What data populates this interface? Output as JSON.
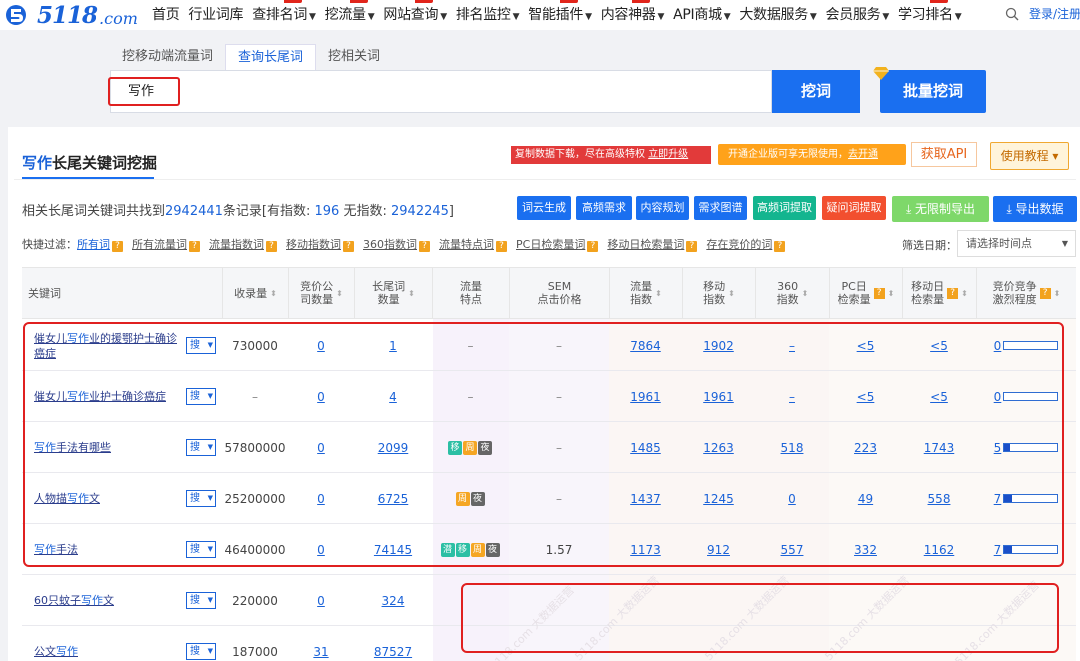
{
  "logo": {
    "text": "5118",
    "suffix": ".com"
  },
  "nav": {
    "items": [
      {
        "label": "首页",
        "caret": false,
        "new": false
      },
      {
        "label": "行业词库",
        "caret": false,
        "new": false
      },
      {
        "label": "查排名词",
        "caret": true,
        "new": true
      },
      {
        "label": "挖流量",
        "caret": true,
        "new": true
      },
      {
        "label": "网站查询",
        "caret": true,
        "new": true
      },
      {
        "label": "排名监控",
        "caret": true,
        "new": false
      },
      {
        "label": "智能插件",
        "caret": true,
        "new": true
      },
      {
        "label": "内容神器",
        "caret": true,
        "new": true
      },
      {
        "label": "API商城",
        "caret": true,
        "new": false
      },
      {
        "label": "大数据服务",
        "caret": true,
        "new": false
      },
      {
        "label": "会员服务",
        "caret": true,
        "new": false
      },
      {
        "label": "学习排名",
        "caret": true,
        "new": true
      }
    ],
    "login": "登录/注册"
  },
  "tabs": [
    "挖移动端流量词",
    "查询长尾词",
    "挖相关词"
  ],
  "search": {
    "value": "写作",
    "dig_button": "挖词",
    "batch_button": "批量挖词"
  },
  "panel": {
    "title_kw": "写作",
    "title_rest": "长尾关键词挖掘",
    "notice1_text": "复制数据下载，尽在高级特权 ",
    "notice1_link": "立即升级",
    "notice2_text": "开通企业版可享无限使用，",
    "notice2_link": "去开通",
    "api_button": "获取API",
    "tutorial_button": "使用教程 ▾"
  },
  "summary": {
    "prefix": "相关长尾词关键词共找到",
    "total": "2942441",
    "mid1": "条记录[有指数: ",
    "with_index": "196",
    "mid2": " 无指数: ",
    "without_index": "2942245",
    "suffix": "]"
  },
  "action_buttons": [
    {
      "label": "词云生成",
      "color": "#1a6ff0"
    },
    {
      "label": "高频需求",
      "color": "#1a6ff0"
    },
    {
      "label": "内容规划",
      "color": "#1a6ff0"
    },
    {
      "label": "需求图谱",
      "color": "#1a6ff0"
    },
    {
      "label": "高频词提取",
      "color": "#13b58f"
    },
    {
      "label": "疑问词提取",
      "color": "#f24f2f"
    },
    {
      "label": "⤓ 无限制导出",
      "color": "#7ed86a"
    },
    {
      "label": "⤓ 导出数据",
      "color": "#1a6ff0"
    }
  ],
  "filter": {
    "label": "快捷过滤：",
    "items": [
      "所有词",
      "所有流量词",
      "流量指数词",
      "移动指数词",
      "360指数词",
      "流量特点词",
      "PC日检索量词",
      "移动日检索量词",
      "存在竞价的词"
    ],
    "date_label": "筛选日期：",
    "date_placeholder": "请选择时间点"
  },
  "table": {
    "headers": [
      "关键词",
      "收录量",
      "竞价公\n司数量",
      "长尾词\n数量",
      "流量\n特点",
      "SEM\n点击价格",
      "流量\n指数",
      "移动\n指数",
      "360\n指数",
      "PC日\n检索量",
      "移动日\n检索量",
      "竞价竞争\n激烈程度"
    ],
    "rows": [
      {
        "kw_pre": "催女儿",
        "kw_hl": "写作",
        "kw_post": "业的援鄂护士确诊癌症",
        "indexed": "730000",
        "bid": "0",
        "longtail": "1",
        "tags": [],
        "sem": "–",
        "flow": "7864",
        "mobile": "1902",
        "idx360": "–",
        "pc": "<5",
        "mob_daily": "<5",
        "comp": "0",
        "comp_pct": 0
      },
      {
        "kw_pre": "催女儿",
        "kw_hl": "写作",
        "kw_post": "业护士确诊癌症",
        "indexed": "–",
        "bid": "0",
        "longtail": "4",
        "tags": [],
        "sem": "–",
        "flow": "1961",
        "mobile": "1961",
        "idx360": "–",
        "pc": "<5",
        "mob_daily": "<5",
        "comp": "0",
        "comp_pct": 0
      },
      {
        "kw_pre": "",
        "kw_hl": "写作",
        "kw_post": "手法有哪些",
        "indexed": "57800000",
        "bid": "0",
        "longtail": "2099",
        "tags": [
          "移",
          "周",
          "夜"
        ],
        "sem": "–",
        "flow": "1485",
        "mobile": "1263",
        "idx360": "518",
        "pc": "223",
        "mob_daily": "1743",
        "comp": "5",
        "comp_pct": 10
      },
      {
        "kw_pre": "人物描",
        "kw_hl": "写作",
        "kw_post": "文",
        "indexed": "25200000",
        "bid": "0",
        "longtail": "6725",
        "tags": [
          "周",
          "夜"
        ],
        "sem": "–",
        "flow": "1437",
        "mobile": "1245",
        "idx360": "0",
        "pc": "49",
        "mob_daily": "558",
        "comp": "7",
        "comp_pct": 14
      },
      {
        "kw_pre": "",
        "kw_hl": "写作",
        "kw_post": "手法",
        "indexed": "46400000",
        "bid": "0",
        "longtail": "74145",
        "tags": [
          "潜",
          "移",
          "周",
          "夜"
        ],
        "sem": "1.57",
        "flow": "1173",
        "mobile": "912",
        "idx360": "557",
        "pc": "332",
        "mob_daily": "1162",
        "comp": "7",
        "comp_pct": 14
      },
      {
        "kw_pre": "60只蚊子",
        "kw_hl": "写作",
        "kw_post": "文",
        "indexed": "220000",
        "bid": "0",
        "longtail": "324",
        "tags": [],
        "sem": "",
        "flow": "",
        "mobile": "",
        "idx360": "",
        "pc": "",
        "mob_daily": "",
        "comp": "",
        "comp_pct": 0
      },
      {
        "kw_pre": "公文",
        "kw_hl": "写作",
        "kw_post": "",
        "indexed": "187000",
        "bid": "31",
        "longtail": "87527",
        "tags": [],
        "sem": "",
        "flow": "",
        "mobile": "",
        "idx360": "",
        "pc": "",
        "mob_daily": "",
        "comp": "",
        "comp_pct": 0
      }
    ],
    "search_dropdown": "搜",
    "tag_colors": {
      "潜": "#2bbfa4",
      "移": "#2bbfa4",
      "周": "#f5a623",
      "夜": "#666666"
    }
  },
  "watermark": "5118.com 大数据运营"
}
